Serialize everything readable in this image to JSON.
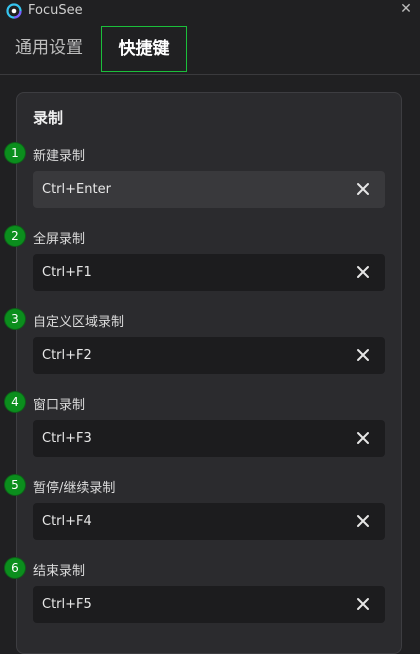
{
  "window": {
    "title": "FocuSee"
  },
  "tabs": [
    {
      "label": "通用设置"
    },
    {
      "label": "快捷键"
    }
  ],
  "section": {
    "title": "录制"
  },
  "shortcuts": [
    {
      "badge": "1",
      "label": "新建录制",
      "value": "Ctrl+Enter"
    },
    {
      "badge": "2",
      "label": "全屏录制",
      "value": "Ctrl+F1"
    },
    {
      "badge": "3",
      "label": "自定义区域录制",
      "value": "Ctrl+F2"
    },
    {
      "badge": "4",
      "label": "窗口录制",
      "value": "Ctrl+F3"
    },
    {
      "badge": "5",
      "label": "暂停/继续录制",
      "value": "Ctrl+F4"
    },
    {
      "badge": "6",
      "label": "结束录制",
      "value": "Ctrl+F5"
    }
  ],
  "colors": {
    "accent": "#1bbf3b",
    "badge": "#0b8e1d",
    "background": "#202022",
    "panel": "#2b2b2e"
  },
  "icons": {
    "app": "focusee-logo-icon",
    "close": "close-icon",
    "clear": "clear-x-icon"
  }
}
